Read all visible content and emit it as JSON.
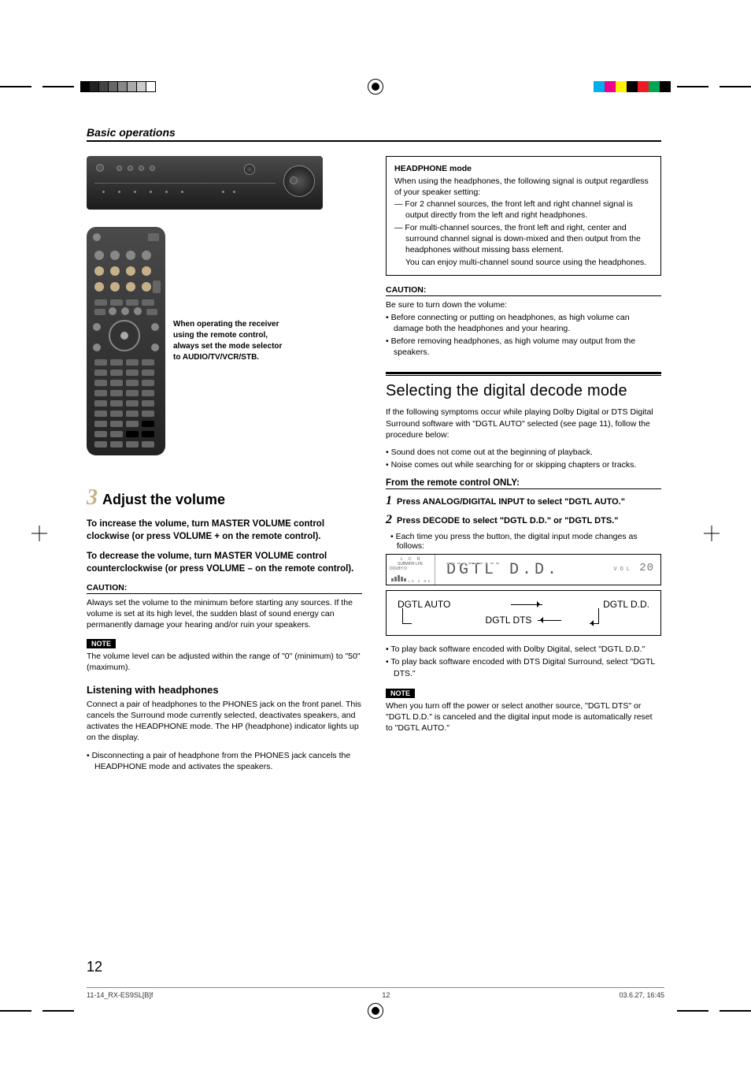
{
  "breadcrumb": "Basic operations",
  "remote_note": "When operating the receiver using the remote control, always set the mode selector to AUDIO/TV/VCR/STB.",
  "step3": {
    "num": "3",
    "title": "Adjust the volume",
    "increase": "To increase the volume, turn MASTER VOLUME control clockwise (or press VOLUME + on the remote control).",
    "decrease": "To decrease the volume, turn MASTER VOLUME control counterclockwise (or press VOLUME – on the remote control).",
    "caution_label": "CAUTION:",
    "caution_text": "Always set the volume to the minimum before starting any sources. If the volume is set at its high level, the sudden blast of sound energy can permanently damage your hearing and/or ruin your speakers.",
    "note_label": "NOTE",
    "note_text": "The volume level can be adjusted within the range of \"0\" (minimum) to \"50\" (maximum)."
  },
  "headphones": {
    "heading": "Listening with headphones",
    "p1": "Connect a pair of headphones to the PHONES jack on the front panel. This cancels the Surround mode currently selected, deactivates speakers, and activates the HEADPHONE mode. The HP (headphone) indicator lights up on the display.",
    "b1": "• Disconnecting a pair of headphone from the PHONES jack cancels the HEADPHONE mode and activates the speakers."
  },
  "hp_box": {
    "head": "HEADPHONE mode",
    "intro": "When using the headphones, the following signal is output regardless of your speaker setting:",
    "d1": "— For 2 channel sources, the front left and right channel signal is output directly from the left and right headphones.",
    "d2": "— For multi-channel sources, the front left and right, center and surround channel signal is down-mixed and then output from the headphones without missing bass element.",
    "d2b": "You can enjoy multi-channel sound source using the headphones."
  },
  "r_caution": {
    "label": "CAUTION:",
    "intro": "Be sure to turn down the volume:",
    "b1": "• Before connecting or putting on headphones, as high volume can damage both the headphones and your hearing.",
    "b2": "• Before removing headphones, as high volume may output from the speakers."
  },
  "decode": {
    "title": "Selecting the digital decode mode",
    "intro": "If the following symptoms occur while playing Dolby Digital or DTS Digital Surround software with \"DGTL AUTO\" selected (see page 11), follow the procedure below:",
    "b1": "• Sound does not come out at the beginning of playback.",
    "b2": "• Noise comes out while searching for or skipping chapters or tracks.",
    "from_remote": "From the remote control ONLY:",
    "s1_num": "1",
    "s1": "Press ANALOG/DIGITAL INPUT to select \"DGTL AUTO.\"",
    "s2_num": "2",
    "s2": "Press DECODE to select \"DGTL D.D.\" or \"DGTL DTS.\"",
    "s2_sub": "• Each time you press the button, the digital input mode changes as follows:",
    "lcd_text": "DGTL  D.D.",
    "lcd_vol_label": "VOL",
    "lcd_vol_value": "20",
    "cycle_a": "DGTL AUTO",
    "cycle_b": "DGTL D.D.",
    "cycle_c": "DGTL DTS",
    "b3": "• To play back software encoded with Dolby Digital, select \"DGTL D.D.\"",
    "b4": "• To play back software encoded with DTS Digital Surround, select \"DGTL DTS.\"",
    "note_label": "NOTE",
    "note_text": "When you turn off the power or select another source, \"DGTL DTS\" or \"DGTL D.D.\" is canceled and the digital input mode is automatically reset to \"DGTL AUTO.\""
  },
  "lcd_indicators": {
    "top_row": "L  C  R",
    "sub": "SUBWFR LFE",
    "dolby": "DOLBY D",
    "bars": "LS  S  RS"
  },
  "page_number": "12",
  "footer": {
    "file": "11-14_RX-ES9SL[B]f",
    "page": "12",
    "date": "03.6.27, 16:45"
  },
  "swatch_colors": [
    "#00aeef",
    "#ec008c",
    "#fff200",
    "#000000",
    "#ed1c24",
    "#00a651",
    "#000000"
  ],
  "mono_shades": [
    "#000",
    "#222",
    "#444",
    "#666",
    "#888",
    "#aaa",
    "#ccc",
    "#fff"
  ]
}
